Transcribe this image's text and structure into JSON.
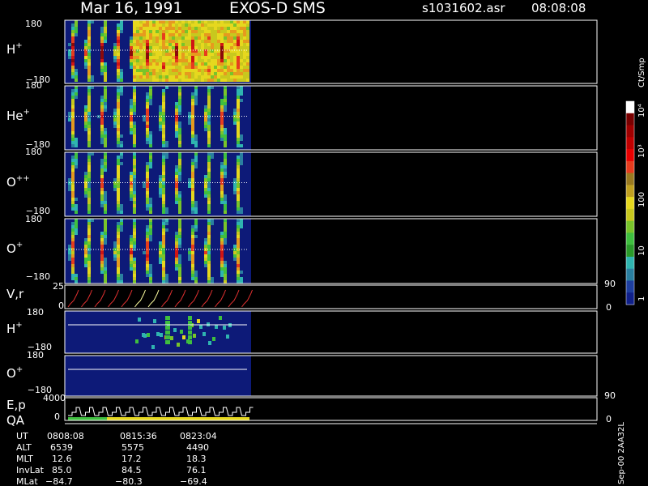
{
  "header": {
    "date": "Mar 16, 1991",
    "instrument": "EXOS-D SMS",
    "file": "s1031602.asr",
    "time": "08:08:08"
  },
  "colorbar": {
    "unit_label": "Ct/Smp",
    "ticks": [
      "10⁴",
      "10³",
      "100",
      "10",
      "1"
    ]
  },
  "footer_id": "Sep-00 2AA32L",
  "panels": [
    {
      "key": "h_plus",
      "ion": "H",
      "charge": "+",
      "ymax": "180",
      "ymin": "−180",
      "intensity": 1.0
    },
    {
      "key": "he_plus",
      "ion": "He",
      "charge": "+",
      "ymax": "180",
      "ymin": "−180",
      "intensity": 0.8
    },
    {
      "key": "o_pp",
      "ion": "O",
      "charge": "++",
      "ymax": "180",
      "ymin": "−180",
      "intensity": 0.75
    },
    {
      "key": "o_plus",
      "ion": "O",
      "charge": "+",
      "ymax": "180",
      "ymin": "−180",
      "intensity": 0.85
    }
  ],
  "vr_panel": {
    "label": "V,r",
    "ymax": "25",
    "ymin": "0",
    "right_top": "90",
    "right_bottom": "0"
  },
  "lower_panels": [
    {
      "key": "h_plus_2",
      "ion": "H",
      "charge": "+",
      "ymax": "180",
      "ymin": "−180"
    },
    {
      "key": "o_plus_2",
      "ion": "O",
      "charge": "+",
      "ymax": "180",
      "ymin": "−180"
    }
  ],
  "ep_panel": {
    "label_top": "E,p",
    "label_bottom": "QA",
    "ymax": "4000",
    "ymin": "0",
    "right_top": "90",
    "right_bottom": "0"
  },
  "ephemeris": {
    "row_labels": [
      "UT",
      "ALT",
      "MLT",
      "InvLat",
      "MLat"
    ],
    "columns": [
      [
        "0808:08",
        "6539",
        "12.6",
        "85.0",
        "−84.7"
      ],
      [
        "0815:36",
        "5575",
        "17.2",
        "84.5",
        "−80.3"
      ],
      [
        "0823:04",
        "4490",
        "18.3",
        "76.1",
        "−69.4"
      ]
    ]
  },
  "chart_data": {
    "type": "heatmap",
    "title": "Mar 16, 1991   EXOS-D SMS",
    "series": [
      {
        "name": "H+"
      },
      {
        "name": "He+"
      },
      {
        "name": "O++"
      },
      {
        "name": "O+"
      }
    ],
    "ylim": [
      -180,
      180
    ],
    "colorscale_ticks": [
      "1",
      "10",
      "100",
      "10³",
      "10⁴"
    ],
    "x_ticks": [
      "0808:08",
      "0815:36",
      "0823:04"
    ]
  }
}
